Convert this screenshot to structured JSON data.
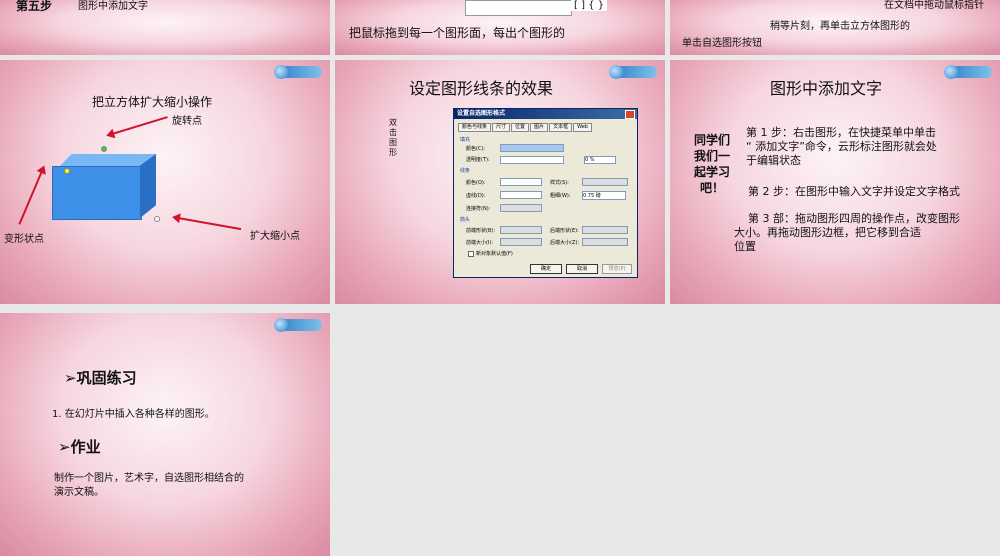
{
  "slide1": {
    "step": "第五步",
    "title": "图形中添加文字"
  },
  "slide2": {
    "text": "把鼠标拖到每一个图形面，每出个图形的",
    "toolbar": "[ ] { }"
  },
  "slide3": {
    "line1": "在文档中拖动鼠标指针",
    "line2": "稍等片刻，再单击立方体图形的",
    "line3": "单击自选图形按钮"
  },
  "slide4": {
    "title": "把立方体扩大缩小操作",
    "rotate_label": "旋转点",
    "deform_label": "变形状点",
    "resize_label": "扩大缩小点"
  },
  "slide5": {
    "title": "设定图形线条的效果",
    "side_note": "双击图形",
    "dialog": {
      "title": "设置自选图形格式",
      "tabs": [
        "颜色与线条",
        "尺寸",
        "位置",
        "图片",
        "文本框",
        "Web"
      ],
      "fill_section": "填充",
      "color_label": "颜色(C):",
      "transparency_label": "透明度(T):",
      "transparency_value": "0 %",
      "line_section": "线条",
      "line_color_label": "颜色(O):",
      "dash_label": "虚线(D):",
      "connector_label": "连接符(N):",
      "style_label": "样式(S):",
      "weight_label": "粗细(W):",
      "weight_value": "0.75 磅",
      "arrow_section": "箭头",
      "begin_style_label": "前端形状(B):",
      "begin_size_label": "前端大小(I):",
      "end_style_label": "后端形状(E):",
      "end_size_label": "后端大小(Z):",
      "default_checkbox": "新对象默认值(F)",
      "ok": "确定",
      "cancel": "取消",
      "preview": "预览(P)"
    }
  },
  "slide6": {
    "title": "图形中添加文字",
    "side": [
      "同学们",
      "我们一",
      "起学习",
      "吧！"
    ],
    "step1": "第 1 步：右击图形，在快捷菜单中单击“ 添加文字”命令，云形标注图形就会处于编辑状态",
    "step1_a": "第 1  步：右击图形，在快捷菜单中单击",
    "step1_b": "“ 添加文字”命令，云形标注图形就会处",
    "step1_c": "于编辑状态",
    "step2": "第 2 步：在图形中输入文字并设定文字格式",
    "step3_a": "第 3  部：拖动图形四周的操作点，改变图形",
    "step3_b": "大小。再拖动图形边框，把它移到合适",
    "step3_c": "位置"
  },
  "slide7": {
    "heading1": "➢巩固练习",
    "item1": "1. 在幻灯片中插入各种各样的图形。",
    "heading2": "➢作业",
    "hw_a": "制作一个图片，艺术字，自选图形相结合的",
    "hw_b": "演示文稿。"
  }
}
